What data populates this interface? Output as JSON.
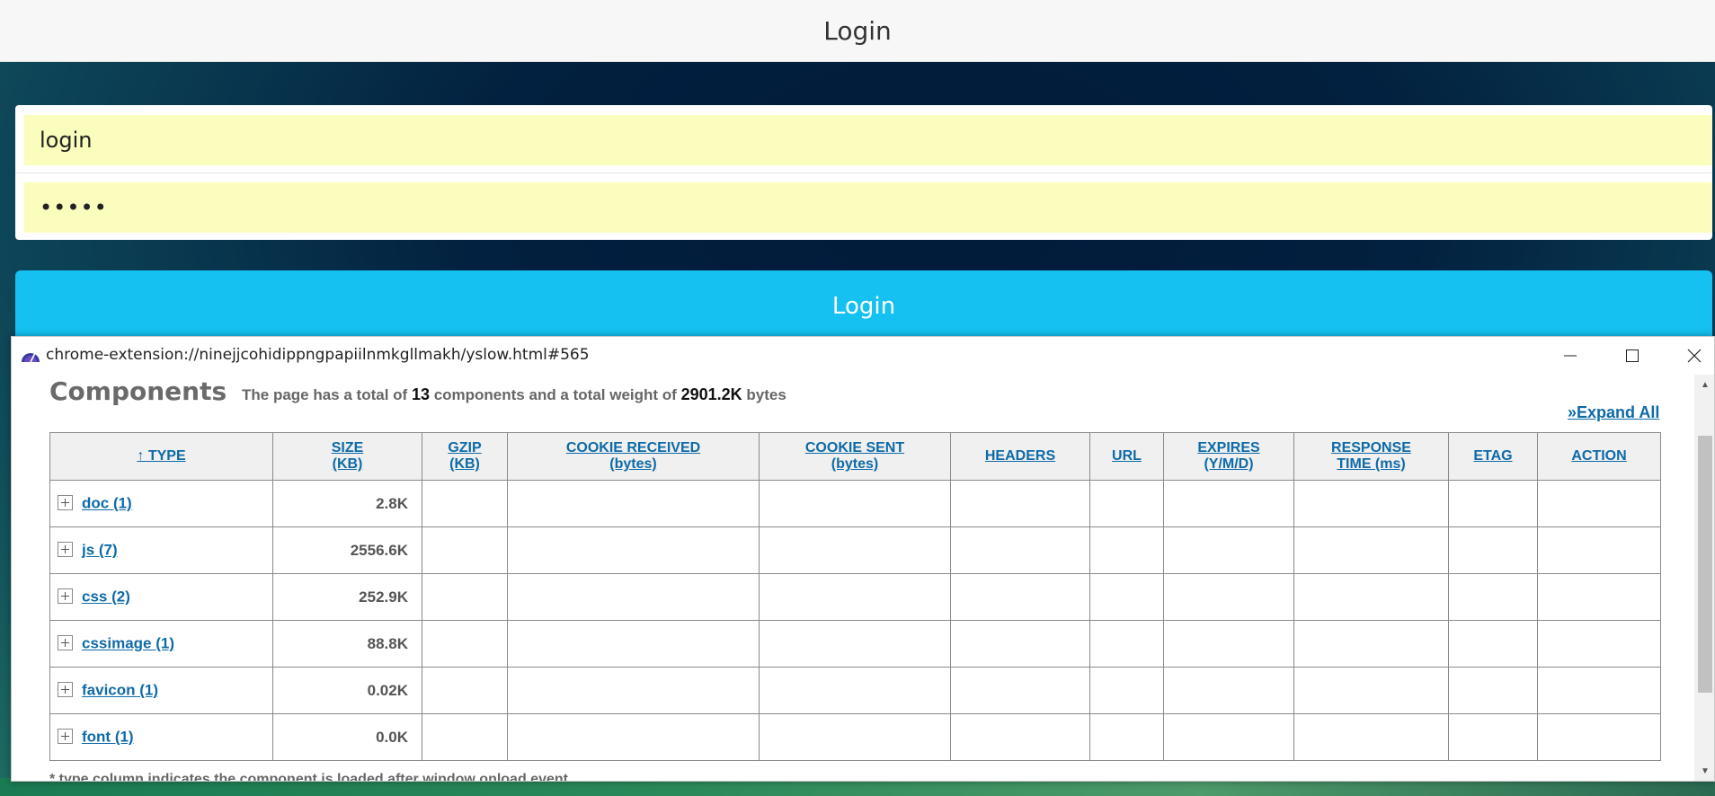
{
  "app": {
    "header_title": "Login",
    "username_value": "login",
    "password_value": "•••••",
    "login_button": "Login"
  },
  "popup": {
    "window_title": "chrome-extension://ninejjcohidippngpapiilnmkgllmakh/yslow.html#565",
    "components_title": "Components",
    "summary": {
      "prefix": "The page has a total of",
      "component_count": "13",
      "middle": "components and a total weight of",
      "total_weight": "2901.2K",
      "suffix": "bytes"
    },
    "expand_all": "»Expand All",
    "columns": [
      {
        "line1": "↑ TYPE",
        "line2": ""
      },
      {
        "line1": "SIZE",
        "line2": "(KB)"
      },
      {
        "line1": "GZIP",
        "line2": "(KB)"
      },
      {
        "line1": "COOKIE RECEIVED",
        "line2": "(bytes)"
      },
      {
        "line1": "COOKIE SENT",
        "line2": "(bytes)"
      },
      {
        "line1": "HEADERS",
        "line2": ""
      },
      {
        "line1": "URL",
        "line2": ""
      },
      {
        "line1": "EXPIRES",
        "line2": "(Y/M/D)"
      },
      {
        "line1": "RESPONSE",
        "line2": "TIME (ms)"
      },
      {
        "line1": "ETAG",
        "line2": ""
      },
      {
        "line1": "ACTION",
        "line2": ""
      }
    ],
    "rows": [
      {
        "type": "doc (1)",
        "size": "2.8K"
      },
      {
        "type": "js (7)",
        "size": "2556.6K"
      },
      {
        "type": "css (2)",
        "size": "252.9K"
      },
      {
        "type": "cssimage (1)",
        "size": "88.8K"
      },
      {
        "type": "favicon (1)",
        "size": "0.02K"
      },
      {
        "type": "font (1)",
        "size": "0.0K"
      }
    ],
    "footnote": "* type column indicates the component is loaded after window onload event"
  },
  "colors": {
    "login_button": "#14c1f0",
    "input_fill": "#fafdbc",
    "link": "#0e6aa8"
  }
}
